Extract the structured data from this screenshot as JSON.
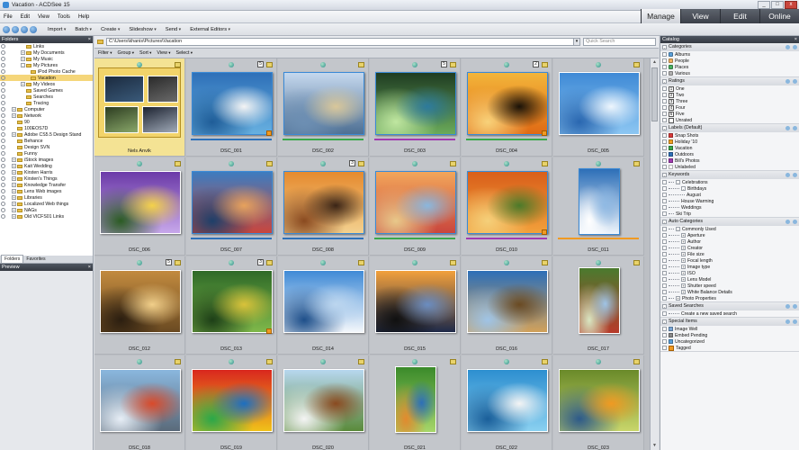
{
  "window": {
    "title": "Vacation - ACDSee 15",
    "controls": [
      "_",
      "□",
      "x"
    ]
  },
  "menu": [
    "File",
    "Edit",
    "View",
    "Tools",
    "Help"
  ],
  "modes": [
    {
      "label": "Manage",
      "active": true
    },
    {
      "label": "View",
      "active": false
    },
    {
      "label": "Edit",
      "active": false
    },
    {
      "label": "Online",
      "active": false
    }
  ],
  "toolbar": [
    "Import",
    "Batch",
    "Create",
    "Slideshow",
    "Send",
    "External Editors"
  ],
  "folders": {
    "header": "Folders",
    "items": [
      {
        "label": "Links",
        "indent": 3,
        "exp": ""
      },
      {
        "label": "My Documents",
        "indent": 3,
        "exp": "+"
      },
      {
        "label": "My Music",
        "indent": 3,
        "exp": "+"
      },
      {
        "label": "My Pictures",
        "indent": 3,
        "exp": "-"
      },
      {
        "label": "iPod Photo Cache",
        "indent": 4,
        "exp": ""
      },
      {
        "label": "Vacation",
        "indent": 4,
        "exp": "",
        "selected": true
      },
      {
        "label": "My Videos",
        "indent": 3,
        "exp": "+"
      },
      {
        "label": "Saved Games",
        "indent": 3,
        "exp": ""
      },
      {
        "label": "Searches",
        "indent": 3,
        "exp": ""
      },
      {
        "label": "Tracing",
        "indent": 3,
        "exp": ""
      },
      {
        "label": "Computer",
        "indent": 1,
        "exp": "+"
      },
      {
        "label": "Network",
        "indent": 1,
        "exp": "+"
      },
      {
        "label": "90",
        "indent": 1,
        "exp": ""
      },
      {
        "label": "100EOS7D",
        "indent": 1,
        "exp": ""
      },
      {
        "label": "Adobe CS5.5 Design Stand",
        "indent": 1,
        "exp": "+"
      },
      {
        "label": "Behance",
        "indent": 1,
        "exp": ""
      },
      {
        "label": "Design SVN",
        "indent": 1,
        "exp": ""
      },
      {
        "label": "Funny",
        "indent": 1,
        "exp": ""
      },
      {
        "label": "iStock images",
        "indent": 1,
        "exp": "+"
      },
      {
        "label": "Kait Wedding",
        "indent": 1,
        "exp": "+"
      },
      {
        "label": "Kirsten Harris",
        "indent": 1,
        "exp": "+"
      },
      {
        "label": "Kirsten's Things",
        "indent": 1,
        "exp": "+"
      },
      {
        "label": "Knowledge Transfer",
        "indent": 1,
        "exp": "+"
      },
      {
        "label": "Lens Web images",
        "indent": 1,
        "exp": "+"
      },
      {
        "label": "Libraries",
        "indent": 1,
        "exp": "+"
      },
      {
        "label": "Localized Web things",
        "indent": 1,
        "exp": "+"
      },
      {
        "label": "NAGs",
        "indent": 1,
        "exp": "+"
      },
      {
        "label": "Old VICFS01 Links",
        "indent": 1,
        "exp": "+"
      }
    ],
    "tabs": [
      {
        "label": "Folders",
        "active": true
      },
      {
        "label": "Favorites",
        "active": false
      }
    ]
  },
  "preview": {
    "header": "Preview"
  },
  "browser": {
    "path": "C:\\Users\\khanis\\Pictures\\Vacation",
    "search_placeholder": "Quick Search",
    "filters": [
      "Filter",
      "Group",
      "Sort",
      "View",
      "Select"
    ]
  },
  "thumbnails": [
    {
      "label": "Nels Anvik",
      "folder": true,
      "selected": true
    },
    {
      "label": "DSC_001",
      "colors": [
        "#2e70b8",
        "#67b0e0",
        "#f4f4f4",
        "#1f5d98"
      ],
      "badge_num": "5",
      "bar": "#2e70b8",
      "tagged": true
    },
    {
      "label": "DSC_002",
      "colors": [
        "#c5d8ee",
        "#4d6f93",
        "#d9c79a",
        "#6d8fb3"
      ],
      "bar": "#3aa84a"
    },
    {
      "label": "DSC_003",
      "colors": [
        "#1f3c22",
        "#6aaa5a",
        "#2d7a9c",
        "#bfe6a0"
      ],
      "badge_num": "5",
      "bar": "#a23ab0"
    },
    {
      "label": "DSC_004",
      "colors": [
        "#f3b53a",
        "#e06a14",
        "#1a1208",
        "#f8d27a"
      ],
      "badge_num": "2",
      "bar": "#3aa84a",
      "tagged": true
    },
    {
      "label": "DSC_005",
      "colors": [
        "#3f8ad6",
        "#8cc6f2",
        "#eef6fd",
        "#2a67b0"
      ]
    },
    {
      "label": "DSC_006",
      "colors": [
        "#6b3aa8",
        "#c7a7ea",
        "#f4d24a",
        "#2b5b23"
      ]
    },
    {
      "label": "DSC_007",
      "colors": [
        "#3d7cc0",
        "#c9463d",
        "#e7a25d",
        "#1e3f69"
      ],
      "bar": "#2e70b8"
    },
    {
      "label": "DSC_008",
      "colors": [
        "#e58a2e",
        "#f3d18f",
        "#3a2416",
        "#8a4a20"
      ],
      "badge_num": "3",
      "bar": "#2e70b8"
    },
    {
      "label": "DSC_009",
      "colors": [
        "#f2a65a",
        "#c9463d",
        "#8ab7de",
        "#e8c88a"
      ],
      "bar": "#3aa84a"
    },
    {
      "label": "DSC_010",
      "colors": [
        "#d95f1a",
        "#f2a03b",
        "#4b7a2a",
        "#f5d07a"
      ],
      "bar": "#a23ab0",
      "tagged": true
    },
    {
      "label": "DSC_011",
      "colors": [
        "#2d6fb8",
        "#eef4fb",
        "#8fb9e3",
        "#ffffff"
      ],
      "portrait": true,
      "bar": "#f09a22"
    },
    {
      "label": "DSC_012",
      "colors": [
        "#c28a3e",
        "#6a4a22",
        "#f1cf8a",
        "#2b1e10"
      ],
      "badge_num": "5"
    },
    {
      "label": "DSC_013",
      "colors": [
        "#2f6a28",
        "#7fb84a",
        "#d9c23a",
        "#1d3f17"
      ],
      "badge_num": "3",
      "tagged": true
    },
    {
      "label": "DSC_014",
      "colors": [
        "#3f8ad6",
        "#f4f7fb",
        "#bcd6ef",
        "#1e4f8a"
      ]
    },
    {
      "label": "DSC_015",
      "colors": [
        "#f2a03b",
        "#1e2a4a",
        "#6b8dc1",
        "#101010"
      ]
    },
    {
      "label": "DSC_016",
      "colors": [
        "#2d6fb8",
        "#d2a15a",
        "#6a4a22",
        "#9fc4e6"
      ]
    },
    {
      "label": "DSC_017",
      "colors": [
        "#4a7a2e",
        "#b73a2a",
        "#9fc4e6",
        "#d9e6c2"
      ],
      "portrait": true
    },
    {
      "label": "DSC_018",
      "colors": [
        "#8ab7de",
        "#5a6a7a",
        "#d94a2a",
        "#e7eef6"
      ]
    },
    {
      "label": "DSC_019",
      "colors": [
        "#d9271e",
        "#f0c21a",
        "#1c6fc1",
        "#2aa84a"
      ]
    },
    {
      "label": "DSC_020",
      "colors": [
        "#b7d7ef",
        "#5a8a3a",
        "#8a4a20",
        "#f4f4f4"
      ]
    },
    {
      "label": "DSC_021",
      "colors": [
        "#3a8a2a",
        "#a6d66a",
        "#2d6fb8",
        "#e28a2e"
      ],
      "portrait": true
    },
    {
      "label": "DSC_022",
      "colors": [
        "#2d8fd0",
        "#8ad0f0",
        "#f4f4f4",
        "#1a5f9a"
      ]
    },
    {
      "label": "DSC_023",
      "colors": [
        "#6a8a2a",
        "#c9d66a",
        "#f09a22",
        "#2d5a8a"
      ]
    }
  ],
  "catalog": {
    "header": "Catalog",
    "categories": {
      "title": "Categories",
      "items": [
        {
          "label": "Albums",
          "color": "#5aa0d8"
        },
        {
          "label": "People",
          "color": "#f0b060"
        },
        {
          "label": "Places",
          "color": "#4ab060"
        },
        {
          "label": "Various",
          "color": "#b0b0b0"
        }
      ]
    },
    "ratings": {
      "title": "Ratings",
      "items": [
        {
          "label": "One",
          "n": "1"
        },
        {
          "label": "Two",
          "n": "2"
        },
        {
          "label": "Three",
          "n": "3"
        },
        {
          "label": "Four",
          "n": "4"
        },
        {
          "label": "Five",
          "n": "5"
        },
        {
          "label": "Unrated",
          "n": ""
        }
      ]
    },
    "labels": {
      "title": "Labels (Default)",
      "items": [
        {
          "label": "Snap Shots",
          "color": "#d93a3a"
        },
        {
          "label": "Holiday '10",
          "color": "#f0a020"
        },
        {
          "label": "Vacation",
          "color": "#3aa84a"
        },
        {
          "label": "Outdoors",
          "color": "#2e70b8"
        },
        {
          "label": "Bill's Photos",
          "color": "#a23ab0"
        },
        {
          "label": "Unlabeled",
          "color": "#ffffff"
        }
      ]
    },
    "keywords": {
      "title": "Keywords",
      "items": [
        {
          "label": "Celebrations",
          "indent": 1,
          "exp": "-"
        },
        {
          "label": "Birthdays",
          "indent": 2,
          "exp": "-"
        },
        {
          "label": "August",
          "indent": 3,
          "exp": ""
        },
        {
          "label": "House Warming",
          "indent": 2,
          "exp": ""
        },
        {
          "label": "Weddings",
          "indent": 2,
          "exp": ""
        },
        {
          "label": "Ski Trip",
          "indent": 1,
          "exp": ""
        }
      ]
    },
    "auto": {
      "title": "Auto Categories",
      "items": [
        {
          "label": "Commonly Used",
          "indent": 1,
          "exp": "-"
        },
        {
          "label": "Aperture",
          "indent": 2,
          "exp": "+"
        },
        {
          "label": "Author",
          "indent": 2,
          "exp": "+"
        },
        {
          "label": "Creator",
          "indent": 2,
          "exp": "+"
        },
        {
          "label": "File size",
          "indent": 2,
          "exp": "+"
        },
        {
          "label": "Focal length",
          "indent": 2,
          "exp": "+"
        },
        {
          "label": "Image type",
          "indent": 2,
          "exp": "+"
        },
        {
          "label": "ISO",
          "indent": 2,
          "exp": "+"
        },
        {
          "label": "Lens Model",
          "indent": 2,
          "exp": "+"
        },
        {
          "label": "Shutter speed",
          "indent": 2,
          "exp": "+"
        },
        {
          "label": "White Balance Details",
          "indent": 2,
          "exp": "+"
        },
        {
          "label": "Photo Properties",
          "indent": 1,
          "exp": "+"
        }
      ]
    },
    "saved": {
      "title": "Saved Searches",
      "items": [
        {
          "label": "Create a new saved search",
          "indent": 2,
          "exp": ""
        }
      ]
    },
    "special": {
      "title": "Special Items",
      "items": [
        {
          "label": "Image Well",
          "icon": "#7aa6d6"
        },
        {
          "label": "Embed Pending",
          "icon": "#8a8a8a"
        },
        {
          "label": "Uncategorized",
          "icon": "#5aa0d8"
        },
        {
          "label": "Tagged",
          "icon": "#f09a22",
          "tag": true
        }
      ]
    }
  }
}
